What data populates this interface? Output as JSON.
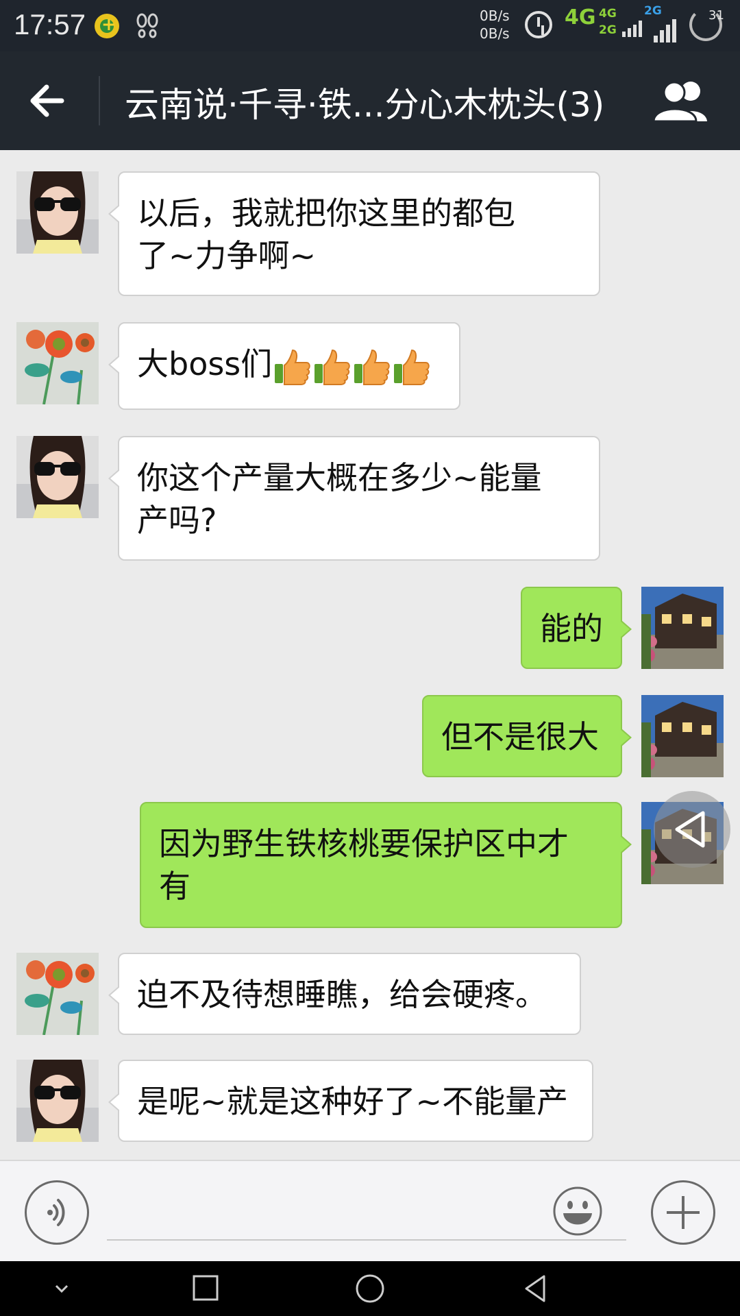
{
  "status_bar": {
    "time": "17:57",
    "speed_up": "0B/s",
    "speed_down": "0B/s",
    "net_4g": "4G",
    "net_4g_small": "4G",
    "net_2g_small": "2G",
    "net_2g": "2G",
    "battery": "31",
    "icons": [
      "app-icon",
      "footprint-icon",
      "alarm-icon",
      "signal-icon",
      "battery-icon"
    ]
  },
  "header": {
    "title": "云南说·千寻·铁...分心木枕头(3)",
    "back_icon": "arrow-left-icon",
    "members_icon": "group-icon"
  },
  "messages": [
    {
      "side": "left",
      "avatar": "sunglasses-girl",
      "text_lines": [
        "以后，我就把你这里的都包",
        "了~力争啊~"
      ]
    },
    {
      "side": "left",
      "avatar": "flower-drawing",
      "text": "大boss们",
      "emoji": [
        "thumbs-up",
        "thumbs-up",
        "thumbs-up",
        "thumbs-up"
      ]
    },
    {
      "side": "left",
      "avatar": "sunglasses-girl",
      "text_lines": [
        "你这个产量大概在多少~能量",
        "产吗?"
      ]
    },
    {
      "side": "right",
      "avatar": "village-night",
      "text": "能的"
    },
    {
      "side": "right",
      "avatar": "village-night",
      "text": "但不是很大"
    },
    {
      "side": "right",
      "avatar": "village-night",
      "text_lines": [
        "因为野生铁核桃要保护区中才",
        "有"
      ]
    },
    {
      "side": "left",
      "avatar": "flower-drawing",
      "text": "迫不及待想睡瞧，给会硬疼。"
    },
    {
      "side": "left",
      "avatar": "sunglasses-girl",
      "text": "是呢~就是这种好了~不能量产"
    }
  ],
  "input_bar": {
    "voice_icon": "voice-icon",
    "input_value": "",
    "emoji_icon": "smiley-icon",
    "plus_icon": "plus-icon"
  },
  "nav_bar": {
    "icons": [
      "chevron-down-icon",
      "square-icon",
      "circle-icon",
      "triangle-back-icon"
    ]
  },
  "colors": {
    "status_bg": "#1f252d",
    "header_bg": "#22282f",
    "chat_bg": "#ebebeb",
    "bubble_left": "#ffffff",
    "bubble_right": "#a0e75a",
    "accent_4g": "#8ed13a",
    "accent_2g": "#3aa0e8"
  }
}
